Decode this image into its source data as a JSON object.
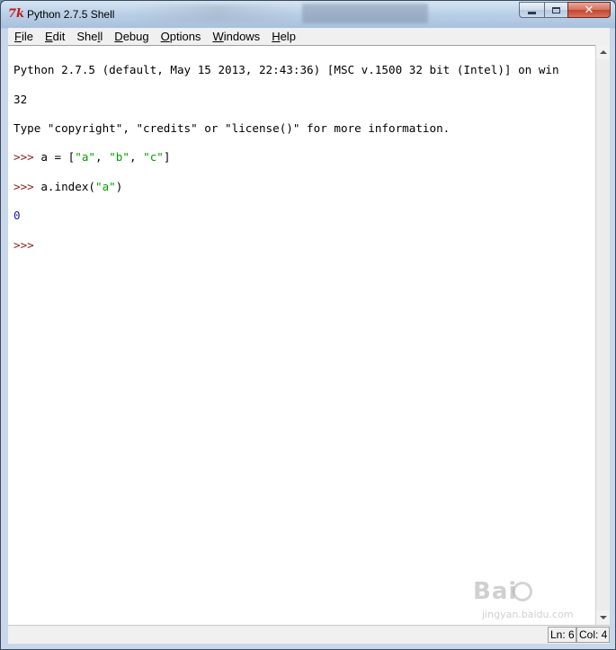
{
  "window": {
    "app_icon_glyph": "7k",
    "title": "Python 2.7.5 Shell"
  },
  "menu": [
    {
      "label": "File",
      "mnemonic": "F",
      "rest": "ile"
    },
    {
      "label": "Edit",
      "mnemonic": "E",
      "rest": "dit"
    },
    {
      "label": "Shell",
      "pre": "She",
      "mnemonic": "l",
      "rest": "l"
    },
    {
      "label": "Debug",
      "mnemonic": "D",
      "rest": "ebug"
    },
    {
      "label": "Options",
      "mnemonic": "O",
      "rest": "ptions"
    },
    {
      "label": "Windows",
      "mnemonic": "W",
      "rest": "indows"
    },
    {
      "label": "Help",
      "mnemonic": "H",
      "rest": "elp"
    }
  ],
  "shell": {
    "banner_line1": "Python 2.7.5 (default, May 15 2013, 22:43:36) [MSC v.1500 32 bit (Intel)] on win",
    "banner_line2": "32",
    "banner_line3": "Type \"copyright\", \"credits\" or \"license()\" for more information.",
    "prompt": ">>> ",
    "cmd1_a": "a = [",
    "cmd1_s1": "\"a\"",
    "cmd1_sep1": ", ",
    "cmd1_s2": "\"b\"",
    "cmd1_sep2": ", ",
    "cmd1_s3": "\"c\"",
    "cmd1_end": "]",
    "cmd2_a": "a.index(",
    "cmd2_s1": "\"a\"",
    "cmd2_end": ")",
    "output1": "0",
    "final_prompt": ">>>"
  },
  "status": {
    "line": "Ln: 6",
    "col": "Col: 4"
  },
  "watermark": {
    "main": "Bai",
    "sub": "jingyan.baidu.com"
  },
  "colors": {
    "prompt": "#8b1a1a",
    "string": "#00a000",
    "output": "#1a1aa6",
    "close_button": "#c2452d"
  },
  "icons": {
    "minimize": "minimize-icon",
    "maximize": "maximize-icon",
    "close": "close-icon",
    "scroll_up": "scroll-up-arrow-icon",
    "scroll_down": "scroll-down-arrow-icon"
  }
}
